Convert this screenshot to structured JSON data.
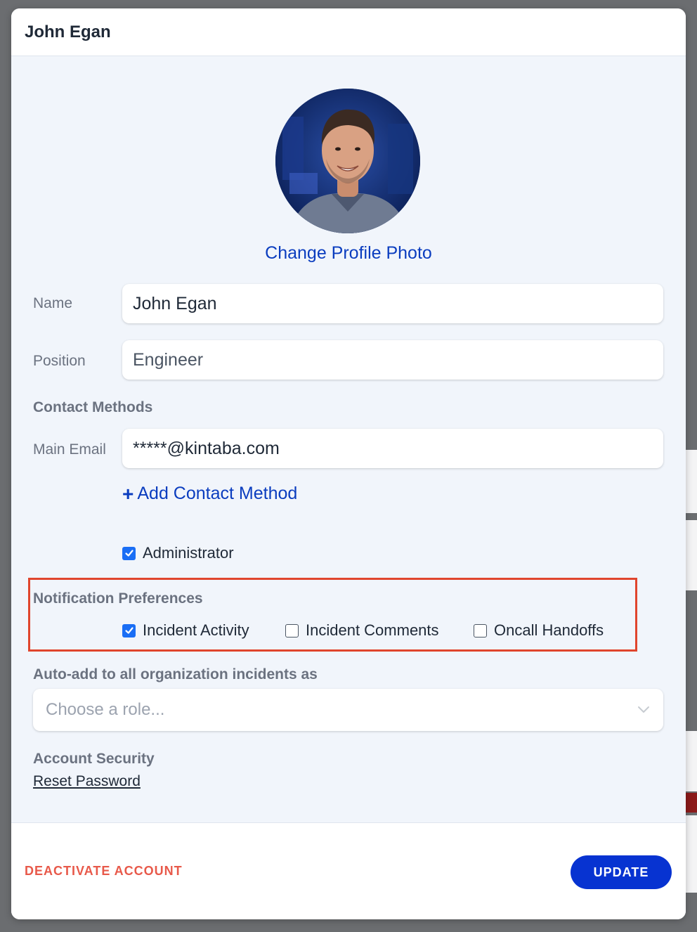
{
  "modal": {
    "title": "John Egan"
  },
  "profile": {
    "change_photo_label": "Change Profile Photo"
  },
  "form": {
    "name_label": "Name",
    "name_value": "John Egan",
    "position_label": "Position",
    "position_value": "Engineer",
    "contact_methods_label": "Contact Methods",
    "main_email_label": "Main Email",
    "main_email_value": "*****@kintaba.com",
    "add_contact_label": "Add Contact Method",
    "administrator_label": "Administrator",
    "administrator_checked": true
  },
  "notifications": {
    "heading": "Notification Preferences",
    "options": [
      {
        "label": "Incident Activity",
        "checked": true
      },
      {
        "label": "Incident Comments",
        "checked": false
      },
      {
        "label": "Oncall Handoffs",
        "checked": false
      }
    ]
  },
  "auto_add": {
    "label": "Auto-add to all organization incidents as",
    "placeholder": "Choose a role..."
  },
  "security": {
    "heading": "Account Security",
    "reset_label": "Reset Password"
  },
  "footer": {
    "deactivate_label": "DEACTIVATE ACCOUNT",
    "update_label": "UPDATE"
  },
  "colors": {
    "accent": "#0733d1",
    "link": "#0b3dbf",
    "danger": "#e8594a",
    "highlight": "#e0452d",
    "checkbox": "#1a6ef5"
  },
  "icons": {
    "plus": "plus-icon",
    "check": "checkmark-icon",
    "chevron": "chevron-down-icon"
  }
}
